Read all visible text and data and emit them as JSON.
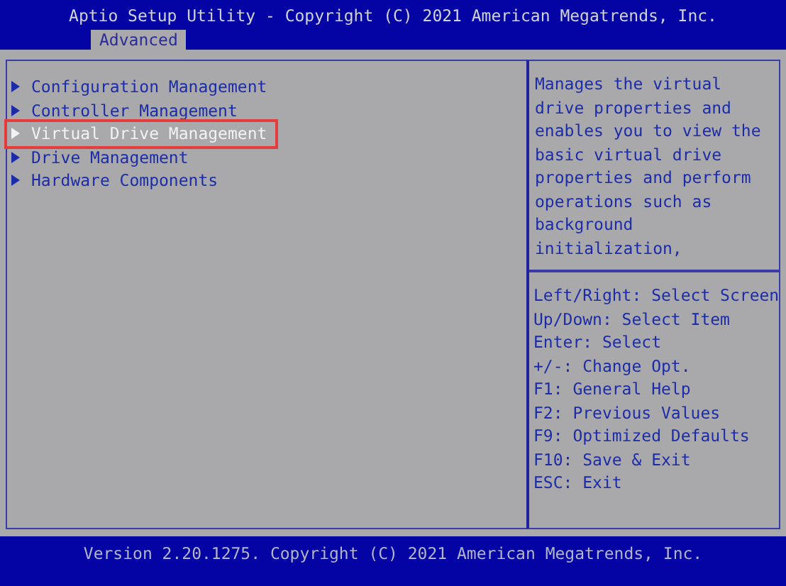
{
  "header": {
    "title": "Aptio Setup Utility - Copyright (C) 2021 American Megatrends, Inc."
  },
  "tabs": [
    {
      "label": "Advanced",
      "selected": true
    }
  ],
  "menu": {
    "items": [
      {
        "label": "Configuration Management",
        "selected": false,
        "outlined": false
      },
      {
        "label": "Controller Management",
        "selected": false,
        "outlined": false
      },
      {
        "label": "Virtual Drive Management",
        "selected": true,
        "outlined": true
      },
      {
        "label": "Drive Management",
        "selected": false,
        "outlined": false
      },
      {
        "label": "Hardware Components",
        "selected": false,
        "outlined": false
      }
    ]
  },
  "help": {
    "description": "Manages the virtual drive properties and enables you to view the basic virtual drive properties and perform operations such as background initialization,",
    "keys": [
      "Left/Right: Select Screen",
      "Up/Down: Select Item",
      "Enter: Select",
      "+/-: Change Opt.",
      "F1: General Help",
      "F2: Previous Values",
      "F9: Optimized Defaults",
      "F10: Save & Exit",
      "ESC: Exit"
    ]
  },
  "footer": {
    "text": "Version 2.20.1275. Copyright (C) 2021 American Megatrends, Inc."
  }
}
